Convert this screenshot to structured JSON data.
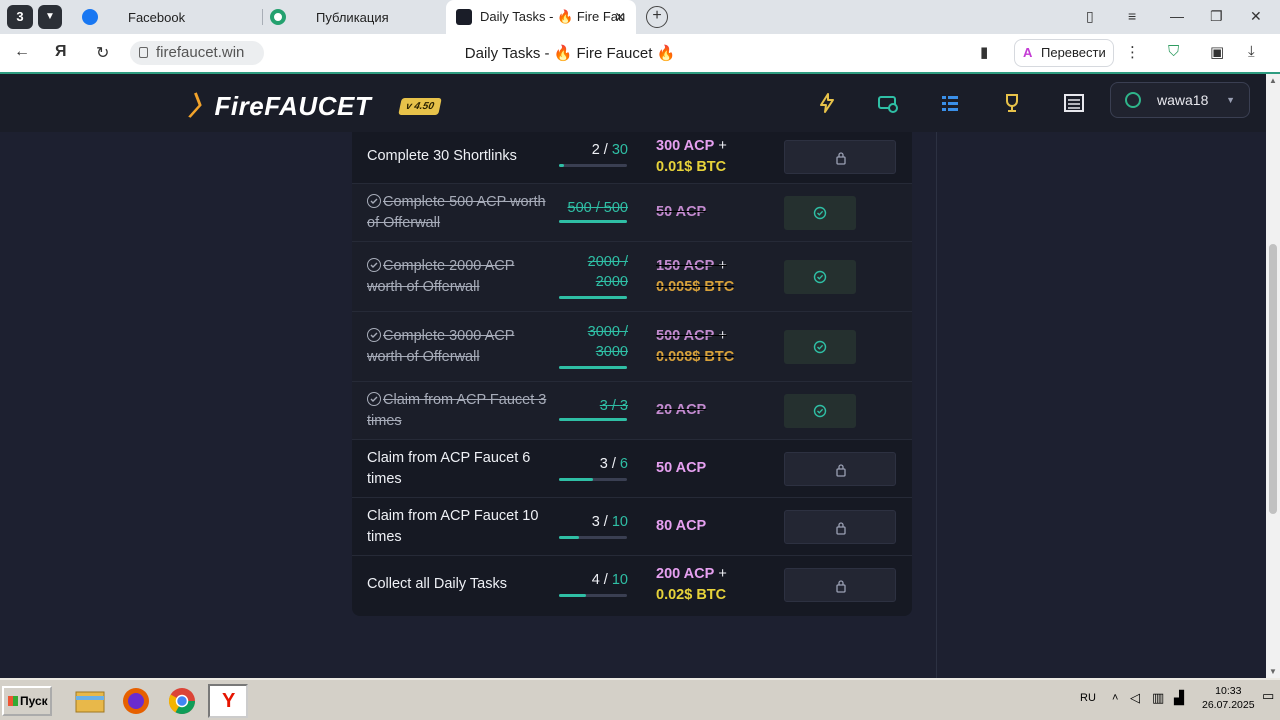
{
  "browser": {
    "tab_count": "3",
    "tabs": [
      {
        "label": "Facebook"
      },
      {
        "label": "Публикация"
      },
      {
        "label": "Daily Tasks - 🔥 Fire Fau"
      }
    ],
    "url": "firefaucet.win",
    "page_title": "Daily Tasks - 🔥 Fire Faucet 🔥",
    "translate_label": "Перевести"
  },
  "site": {
    "logo": "FireFAUCET",
    "version": "v 4.50",
    "username": "wawa18",
    "colors": {
      "accent": "#2fbfa5",
      "acp": "#e6a0f0",
      "btc": "#e7d33a",
      "bg": "#1d2030"
    }
  },
  "tasks": [
    {
      "name": "Complete 30 Shortlinks",
      "check": "",
      "done_count": "2",
      "total": "30",
      "reward_acp": "300 ACP",
      "reward_plus": " +",
      "reward_btc": "0.01$ BTC",
      "progress": 0.07,
      "status": "locked"
    },
    {
      "name": "Complete 500 ACP worth of Offerwall",
      "check": "",
      "done_count": "500",
      "total": "500",
      "reward_acp": "50 ACP",
      "reward_plus": "",
      "reward_btc": "",
      "progress": 1.0,
      "status": "claimed"
    },
    {
      "name": "Complete 2000 ACP worth of Offerwall",
      "check": "",
      "done_count": "2000",
      "total": "2000",
      "reward_acp": "150 ACP",
      "reward_plus": " +",
      "reward_btc": "0.005$ BTC",
      "progress": 1.0,
      "status": "claimed"
    },
    {
      "name": "Complete 3000 ACP worth of Offerwall",
      "check": "",
      "done_count": "3000",
      "total": "3000",
      "reward_acp": "500 ACP",
      "reward_plus": " +",
      "reward_btc": "0.008$ BTC",
      "progress": 1.0,
      "status": "claimed"
    },
    {
      "name": "Claim from ACP Faucet 3 times",
      "check": "",
      "done_count": "3",
      "total": "3",
      "reward_acp": "20 ACP",
      "reward_plus": "",
      "reward_btc": "",
      "progress": 1.0,
      "status": "claimed"
    },
    {
      "name": "Claim from ACP Faucet 6 times",
      "check": "",
      "done_count": "3",
      "total": "6",
      "reward_acp": "50 ACP",
      "reward_plus": "",
      "reward_btc": "",
      "progress": 0.5,
      "status": "locked"
    },
    {
      "name": "Claim from ACP Faucet 10 times",
      "check": "",
      "done_count": "3",
      "total": "10",
      "reward_acp": "80 ACP",
      "reward_plus": "",
      "reward_btc": "",
      "progress": 0.3,
      "status": "locked"
    },
    {
      "name": "Collect all Daily Tasks",
      "check": "",
      "done_count": "4",
      "total": "10",
      "reward_acp": "200 ACP",
      "reward_plus": " +",
      "reward_btc": "0.02$ BTC",
      "progress": 0.4,
      "status": "locked"
    }
  ],
  "taskbar": {
    "start_label": "Пуск",
    "lang": "RU",
    "time": "10:33",
    "date": "26.07.2025"
  }
}
